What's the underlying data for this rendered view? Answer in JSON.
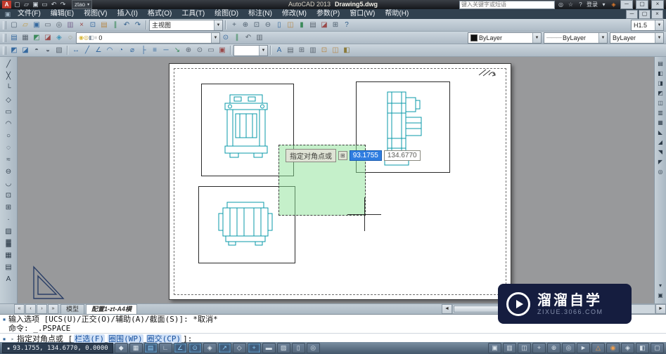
{
  "colors": {
    "accent_blue": "#2f7de0",
    "selection_green": "#8ce196",
    "drawing_cyan": "#0899a8",
    "watermark_navy": "#151d3f"
  },
  "window": {
    "workspace": "ztao",
    "brand": "AutoCAD 2013",
    "doc": "Drawing5.dwg",
    "search_placeholder": "键入关键字或短语",
    "sign_in": "登录",
    "win_buttons": [
      "─",
      "▢",
      "×"
    ],
    "mdi_buttons": [
      "─",
      "▢",
      "×"
    ]
  },
  "qat_icons": [
    {
      "n": "qat-new-icon",
      "g": "▢"
    },
    {
      "n": "qat-open-icon",
      "g": "▱"
    },
    {
      "n": "qat-save-icon",
      "g": "▣"
    },
    {
      "n": "qat-plot-icon",
      "g": "▭"
    },
    {
      "n": "qat-undo-icon",
      "g": "↶"
    },
    {
      "n": "qat-redo-icon",
      "g": "↷"
    }
  ],
  "menus": [
    "文件(F)",
    "编辑(E)",
    "视图(V)",
    "插入(I)",
    "格式(O)",
    "工具(T)",
    "绘图(D)",
    "标注(N)",
    "修改(M)",
    "参数(P)",
    "窗口(W)",
    "帮助(H)"
  ],
  "toolbar1": {
    "group1": [
      {
        "n": "qnew-icon",
        "g": "▢",
        "c": "#4f6070"
      },
      {
        "n": "open-icon",
        "g": "▱",
        "c": "#c09a42"
      },
      {
        "n": "save-icon",
        "g": "▣",
        "c": "#35699f"
      },
      {
        "n": "plot-icon",
        "g": "▭",
        "c": "#5a6570"
      },
      {
        "n": "plot-preview-icon",
        "g": "◎",
        "c": "#5a6570"
      },
      {
        "n": "publish-icon",
        "g": "▥",
        "c": "#7a6a92"
      },
      {
        "n": "cut-icon",
        "g": "×",
        "c": "#9a4a4a"
      },
      {
        "n": "copy-icon",
        "g": "⊡",
        "c": "#35699f"
      },
      {
        "n": "paste-icon",
        "g": "▤",
        "c": "#b5884a"
      },
      {
        "n": "match-properties-icon",
        "g": "∥",
        "c": "#3c8a5a"
      },
      {
        "n": "undo-icon",
        "g": "↶",
        "c": "#2f5d8a"
      },
      {
        "n": "redo-icon",
        "g": "↷",
        "c": "#2f5d8a"
      }
    ],
    "view_combo_value": "主视图",
    "group2": [
      {
        "n": "pan-icon",
        "g": "+",
        "c": "#4f6070"
      },
      {
        "n": "zoom-realtime-icon",
        "g": "⊕",
        "c": "#4f6070"
      },
      {
        "n": "zoom-window-icon",
        "g": "⊡",
        "c": "#4f6070"
      },
      {
        "n": "zoom-previous-icon",
        "g": "⊖",
        "c": "#4f6070"
      },
      {
        "n": "properties-icon",
        "g": "▯",
        "c": "#35699f"
      },
      {
        "n": "designcenter-icon",
        "g": "◫",
        "c": "#b5884a"
      },
      {
        "n": "tool-palettes-icon",
        "g": "▮",
        "c": "#3c8a5a"
      },
      {
        "n": "sheet-set-manager-icon",
        "g": "▤",
        "c": "#5a6570"
      },
      {
        "n": "markup-set-manager-icon",
        "g": "◪",
        "c": "#9a4a4a"
      },
      {
        "n": "quickcalc-icon",
        "g": "⊞",
        "c": "#4f6070"
      },
      {
        "n": "help-icon",
        "g": "?",
        "c": "#2f5d8a"
      }
    ],
    "right_label": "H1.5"
  },
  "toolbar2": {
    "group1": [
      {
        "n": "layer-properties-icon",
        "g": "▤",
        "c": "#35699f"
      },
      {
        "n": "layer-states-icon",
        "g": "▦",
        "c": "#5a6570"
      },
      {
        "n": "layer-isolate-icon",
        "g": "◩",
        "c": "#3c8a5a"
      },
      {
        "n": "layer-unisolate-icon",
        "g": "◪",
        "c": "#9a4a4a"
      },
      {
        "n": "layer-freeze-icon",
        "g": "◈",
        "c": "#3f93b5"
      },
      {
        "n": "layer-off-icon",
        "g": "◌",
        "c": "#8a7a3a"
      }
    ],
    "layer_status_icons": [
      {
        "n": "layer-on-bulb-icon",
        "g": "◉",
        "c": "#d8b83a"
      },
      {
        "n": "layer-thaw-sun-icon",
        "g": "◎",
        "c": "#c8a42e"
      },
      {
        "n": "layer-unlock-icon",
        "g": "◧",
        "c": "#8a97a3"
      },
      {
        "n": "layer-color-chip",
        "g": "■",
        "c": "#d8d8d8"
      }
    ],
    "layer_value": "0",
    "group2": [
      {
        "n": "make-object-layer-current-icon",
        "g": "⊙",
        "c": "#35699f"
      },
      {
        "n": "layer-match-icon",
        "g": "∥",
        "c": "#3c8a5a"
      },
      {
        "n": "layer-previous-icon",
        "g": "↶",
        "c": "#5a6570"
      },
      {
        "n": "layer-walk-icon",
        "g": "▥",
        "c": "#5a6570"
      }
    ],
    "color_value": "ByLayer",
    "linetype_value": "ByLayer",
    "lineweight_value": "ByLayer"
  },
  "toolbar3": {
    "group1": [
      {
        "n": "bring-to-front-icon",
        "g": "◩",
        "c": "#35699f"
      },
      {
        "n": "send-to-back-icon",
        "g": "◪",
        "c": "#35699f"
      },
      {
        "n": "bring-above-icon",
        "g": "◓",
        "c": "#5a6570"
      },
      {
        "n": "send-below-icon",
        "g": "◒",
        "c": "#5a6570"
      },
      {
        "n": "annotation-order-icon",
        "g": "▧",
        "c": "#5a6570"
      }
    ],
    "group2": [
      {
        "n": "dim-linear-icon",
        "g": "↔",
        "c": "#35699f"
      },
      {
        "n": "dim-aligned-icon",
        "g": "╱",
        "c": "#35699f"
      },
      {
        "n": "dim-angular-icon",
        "g": "∠",
        "c": "#35699f"
      },
      {
        "n": "dim-arc-length-icon",
        "g": "◠",
        "c": "#35699f"
      },
      {
        "n": "dim-radius-icon",
        "g": "◔",
        "c": "#35699f"
      },
      {
        "n": "dim-diameter-icon",
        "g": "⌀",
        "c": "#35699f"
      },
      {
        "n": "dim-ordinate-icon",
        "g": "├",
        "c": "#35699f"
      },
      {
        "n": "dim-baseline-icon",
        "g": "≡",
        "c": "#35699f"
      },
      {
        "n": "dim-continue-icon",
        "g": "─",
        "c": "#35699f"
      },
      {
        "n": "multileader-icon",
        "g": "↘",
        "c": "#3c8a5a"
      },
      {
        "n": "tolerance-icon",
        "g": "⊕",
        "c": "#5a6570"
      },
      {
        "n": "center-mark-icon",
        "g": "⊙",
        "c": "#5a6570"
      },
      {
        "n": "dim-edit-icon",
        "g": "▭",
        "c": "#5a6570"
      },
      {
        "n": "dim-style-icon",
        "g": "▣",
        "c": "#9a4a4a"
      }
    ],
    "group3": [
      {
        "n": "text-style-icon",
        "g": "A",
        "c": "#35699f"
      },
      {
        "n": "mtext-icon",
        "g": "▤",
        "c": "#5a6570"
      },
      {
        "n": "table-icon",
        "g": "⊞",
        "c": "#5a6570"
      },
      {
        "n": "field-icon",
        "g": "▥",
        "c": "#5a6570"
      },
      {
        "n": "block-insert-icon",
        "g": "⊡",
        "c": "#b5884a"
      },
      {
        "n": "xref-attach-icon",
        "g": "◫",
        "c": "#b5884a"
      },
      {
        "n": "toolbar-lock-icon",
        "g": "◧",
        "c": "#8a7a3a"
      }
    ]
  },
  "left_toolbar": {
    "icons": [
      {
        "n": "line-icon",
        "g": "╱"
      },
      {
        "n": "construction-line-icon",
        "g": "╳"
      },
      {
        "n": "polyline-icon",
        "g": "└"
      },
      {
        "n": "polygon-icon",
        "g": "◇"
      },
      {
        "n": "rectangle-icon",
        "g": "▭"
      },
      {
        "n": "arc-icon",
        "g": "◠"
      },
      {
        "n": "circle-icon",
        "g": "○"
      },
      {
        "n": "revision-cloud-icon",
        "g": "◌"
      },
      {
        "n": "spline-icon",
        "g": "≈"
      },
      {
        "n": "ellipse-icon",
        "g": "⊖"
      },
      {
        "n": "ellipse-arc-icon",
        "g": "◡"
      },
      {
        "n": "insert-block-icon",
        "g": "⊡"
      },
      {
        "n": "make-block-icon",
        "g": "⊞"
      },
      {
        "n": "point-icon",
        "g": "·"
      },
      {
        "n": "hatch-icon",
        "g": "▨"
      },
      {
        "n": "gradient-icon",
        "g": "▓"
      },
      {
        "n": "region-icon",
        "g": "▦"
      },
      {
        "n": "table-draw-icon",
        "g": "▤"
      },
      {
        "n": "multiline-text-icon",
        "g": "A"
      }
    ]
  },
  "right_toolbar": {
    "icons": [
      {
        "n": "named-views-icon",
        "g": "▤"
      },
      {
        "n": "view-top-icon",
        "g": "◧"
      },
      {
        "n": "view-bottom-icon",
        "g": "◨"
      },
      {
        "n": "view-left-icon",
        "g": "◩"
      },
      {
        "n": "view-right-icon",
        "g": "◫"
      },
      {
        "n": "view-front-icon",
        "g": "▥"
      },
      {
        "n": "view-back-icon",
        "g": "▦"
      },
      {
        "n": "view-sw-iso-icon",
        "g": "◣"
      },
      {
        "n": "view-se-iso-icon",
        "g": "◢"
      },
      {
        "n": "view-ne-iso-icon",
        "g": "◥"
      },
      {
        "n": "view-nw-iso-icon",
        "g": "◤"
      },
      {
        "n": "camera-icon",
        "g": "◎"
      }
    ],
    "bottom_icons": [
      {
        "n": "scroll-down-icon",
        "g": "▾"
      },
      {
        "n": "viewport-dialog-icon",
        "g": "▣"
      }
    ]
  },
  "canvas": {
    "tooltip_label": "指定对角点或",
    "tooltip_tab_icon": "⊞",
    "dyn_x": "93.1755",
    "dyn_y": "134.6770"
  },
  "tabs": {
    "nav": [
      "«",
      "‹",
      "›",
      "»"
    ],
    "model_label": "模型",
    "layout_label": "配置1-zt-A4横",
    "hscroll_left": "◄",
    "hscroll_right": "►"
  },
  "command": {
    "line1_icon": "▪",
    "line1": "输入选项 [UCS(U)/正交(O)/辅助(A)/截面(S)]: *取消*",
    "line2": "命令: _.PSPACE",
    "input_icon1": "▪",
    "input_icon2": "▸",
    "prompt_prefix": "指定对角点或 [",
    "options": [
      "栏选(F)",
      "圈围(WP)",
      "圈交(CP)"
    ],
    "prompt_suffix": "]:"
  },
  "status": {
    "menu_icon": "▪",
    "coords": "93.1755,  134.6770,  0.0000",
    "toggles": [
      {
        "n": "infer-constraints-toggle",
        "g": "◆",
        "state": ""
      },
      {
        "n": "snap-mode-toggle",
        "g": "▦",
        "state": ""
      },
      {
        "n": "grid-display-toggle",
        "g": "▤",
        "state": "active"
      },
      {
        "n": "ortho-mode-toggle",
        "g": "∟",
        "state": ""
      },
      {
        "n": "polar-tracking-toggle",
        "g": "∠",
        "state": "active"
      },
      {
        "n": "object-snap-toggle",
        "g": "⊙",
        "state": "active"
      },
      {
        "n": "3d-object-snap-toggle",
        "g": "◈",
        "state": ""
      },
      {
        "n": "object-snap-tracking-toggle",
        "g": "↗",
        "state": "active"
      },
      {
        "n": "dynamic-ucs-toggle",
        "g": "◇",
        "state": ""
      },
      {
        "n": "dynamic-input-toggle",
        "g": "+",
        "state": "active"
      },
      {
        "n": "lineweight-toggle",
        "g": "▬",
        "state": ""
      },
      {
        "n": "transparency-toggle",
        "g": "▨",
        "state": ""
      },
      {
        "n": "quick-properties-toggle",
        "g": "▯",
        "state": ""
      },
      {
        "n": "selection-cycling-toggle",
        "g": "◎",
        "state": ""
      }
    ],
    "right_buttons": [
      {
        "n": "model-paper-toggle",
        "g": "▣",
        "c": ""
      },
      {
        "n": "quick-view-layouts-icon",
        "g": "▥",
        "c": ""
      },
      {
        "n": "quick-view-drawings-icon",
        "g": "◫",
        "c": ""
      },
      {
        "n": "pan-status-icon",
        "g": "+",
        "c": ""
      },
      {
        "n": "zoom-status-icon",
        "g": "⊕",
        "c": ""
      },
      {
        "n": "steering-wheel-icon",
        "g": "◎",
        "c": ""
      },
      {
        "n": "show-motion-icon",
        "g": "►",
        "c": ""
      },
      {
        "n": "annotation-scale-icon",
        "g": "△",
        "c": "#f0a050"
      },
      {
        "n": "annotation-visibility-icon",
        "g": "◉",
        "c": "#f0a050"
      },
      {
        "n": "workspace-switching-icon",
        "g": "◈",
        "c": ""
      },
      {
        "n": "status-toolbar-lock-icon",
        "g": "◧",
        "c": ""
      },
      {
        "n": "clean-screen-icon",
        "g": "▢",
        "c": ""
      }
    ]
  },
  "watermark": {
    "title": "溜溜自学",
    "subtitle": "ZIXUE.3066.COM"
  }
}
